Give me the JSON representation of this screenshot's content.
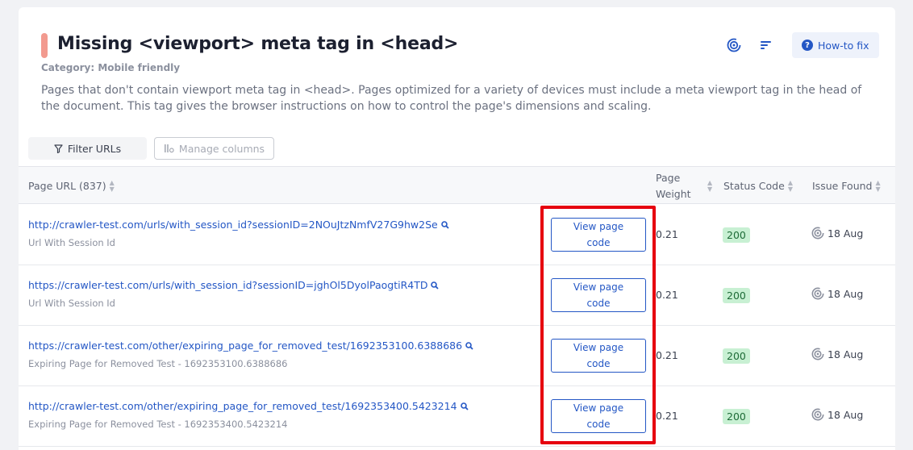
{
  "header": {
    "title": "Missing <viewport> meta tag in <head>",
    "category": "Category: Mobile friendly",
    "description": "Pages that don't contain viewport meta tag in <head>. Pages optimized for a variety of devices must include a meta viewport tag in the head of the document. This tag gives the browser instructions on how to control the page's dimensions and scaling.",
    "accent_color": "#f29a8f",
    "howto_label": "How-to fix"
  },
  "toolbar": {
    "filter_label": "Filter URLs",
    "manage_label": "Manage columns"
  },
  "table": {
    "columns": {
      "page_url": "Page URL (837)",
      "page_weight": "Page Weight",
      "status_code": "Status Code",
      "issue_found": "Issue Found"
    },
    "rows": [
      {
        "url": "http://crawler-test.com/urls/with_session_id?sessionID=2NOuJtzNmfV27G9hw2Se",
        "subtitle": "Url With Session Id",
        "button": "View page code",
        "weight": "0.21",
        "status": "200",
        "issue_date": "18 Aug"
      },
      {
        "url": "https://crawler-test.com/urls/with_session_id?sessionID=jghOl5DyolPaogtiR4TD",
        "subtitle": "Url With Session Id",
        "button": "View page code",
        "weight": "0.21",
        "status": "200",
        "issue_date": "18 Aug"
      },
      {
        "url": "https://crawler-test.com/other/expiring_page_for_removed_test/1692353100.6388686",
        "subtitle": "Expiring Page for Removed Test - 1692353100.6388686",
        "button": "View page code",
        "weight": "0.21",
        "status": "200",
        "issue_date": "18 Aug"
      },
      {
        "url": "http://crawler-test.com/other/expiring_page_for_removed_test/1692353400.5423214",
        "subtitle": "Expiring Page for Removed Test - 1692353400.5423214",
        "button": "View page code",
        "weight": "0.21",
        "status": "200",
        "issue_date": "18 Aug"
      }
    ]
  },
  "colors": {
    "link": "#2457c5",
    "status_bg": "#c8f0d3",
    "highlight": "#e6000f"
  }
}
